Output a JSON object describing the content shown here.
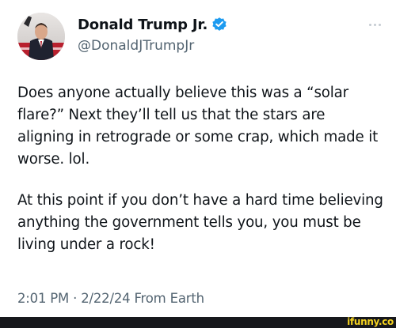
{
  "author": {
    "display_name": "Donald Trump Jr.",
    "handle": "@DonaldJTrumpJr",
    "verified": true,
    "avatar_icon": "profile-photo"
  },
  "more_icon": "ellipsis-icon",
  "tweet": {
    "paragraphs": [
      "Does anyone actually believe this was a “solar flare?” Next they’ll tell us that the stars are aligning in retrograde or some crap, which made it worse. lol.",
      "At this point if you don’t have a hard time believing anything the government tells you, you must be living under a rock!"
    ],
    "timestamp": "2:01 PM · 2/22/24 From Earth"
  },
  "watermark": "ifunny.co",
  "colors": {
    "verified_blue": "#1d9bf0",
    "secondary_text": "#536471",
    "primary_text": "#0f1419",
    "watermark_yellow": "#f4d21f",
    "footer_bg": "#17181c"
  }
}
